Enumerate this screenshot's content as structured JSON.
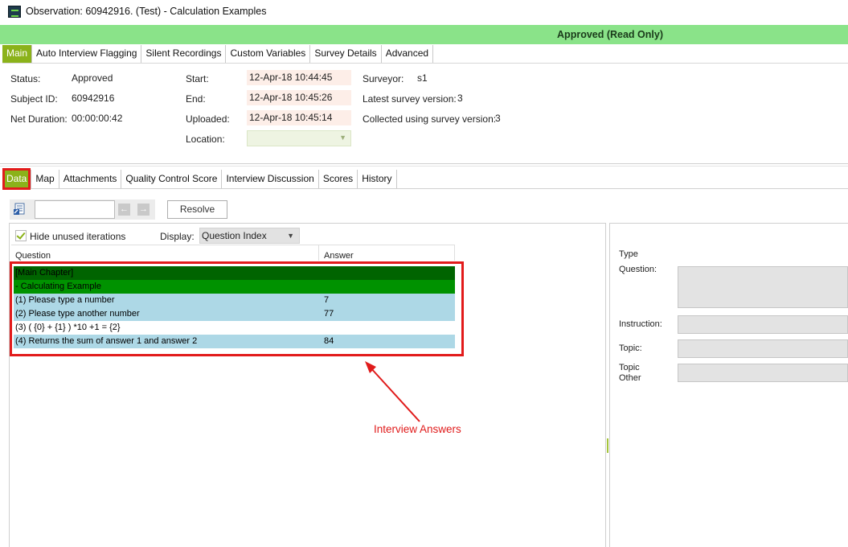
{
  "window": {
    "title": "Observation: 60942916. (Test) - Calculation Examples"
  },
  "status_banner": {
    "text": "Approved (Read Only)",
    "color": "#8ae389"
  },
  "top_tabs": [
    {
      "label": "Main",
      "active": true
    },
    {
      "label": "Auto Interview Flagging"
    },
    {
      "label": "Silent Recordings"
    },
    {
      "label": "Custom Variables"
    },
    {
      "label": "Survey Details"
    },
    {
      "label": "Advanced"
    }
  ],
  "details": {
    "status_label": "Status:",
    "status_value": "Approved",
    "subject_label": "Subject ID:",
    "subject_value": "60942916",
    "duration_label": "Net Duration:",
    "duration_value": "00:00:00:42",
    "start_label": "Start:",
    "start_value": "12-Apr-18 10:44:45",
    "end_label": "End:",
    "end_value": "12-Apr-18 10:45:26",
    "uploaded_label": "Uploaded:",
    "uploaded_value": "12-Apr-18 10:45:14",
    "location_label": "Location:",
    "surveyor_label": "Surveyor:",
    "surveyor_value": "s1",
    "latest_version_label": "Latest survey version:",
    "latest_version_value": "3",
    "collected_version_label": "Collected using survey version:",
    "collected_version_value": "3"
  },
  "data_tabs": [
    {
      "label": "Data",
      "active": true
    },
    {
      "label": "Map"
    },
    {
      "label": "Attachments"
    },
    {
      "label": "Quality Control Score"
    },
    {
      "label": "Interview Discussion"
    },
    {
      "label": "Scores"
    },
    {
      "label": "History"
    }
  ],
  "toolbar": {
    "search_value": "",
    "prev_icon": "arrow-left-icon",
    "next_icon": "arrow-right-icon",
    "resolve_label": "Resolve"
  },
  "options": {
    "hide_unused_label": "Hide unused iterations",
    "hide_unused_checked": true,
    "display_label": "Display:",
    "display_value": "Question Index"
  },
  "grid": {
    "col_question": "Question",
    "col_answer": "Answer",
    "rows": [
      {
        "question": "[Main Chapter]",
        "answer": "",
        "kind": "chapter"
      },
      {
        "question": "- Calculating Example",
        "answer": "",
        "kind": "section"
      },
      {
        "question": "(1) Please type a number",
        "answer": "7",
        "kind": "answered"
      },
      {
        "question": "(2) Please type another number",
        "answer": "77",
        "kind": "answered"
      },
      {
        "question": "(3) ( {0} + {1} ) *10 +1 = {2}",
        "answer": "",
        "kind": "plain"
      },
      {
        "question": "(4) Returns the sum of answer 1 and answer 2",
        "answer": "84",
        "kind": "answered"
      }
    ]
  },
  "annotation": {
    "text": "Interview Answers",
    "color": "#e01b1b"
  },
  "details_panel": {
    "type_label": "Type",
    "question_label": "Question:",
    "instruction_label": "Instruction:",
    "topic_label": "Topic:",
    "topic_other_label_1": "Topic",
    "topic_other_label_2": "Other"
  }
}
